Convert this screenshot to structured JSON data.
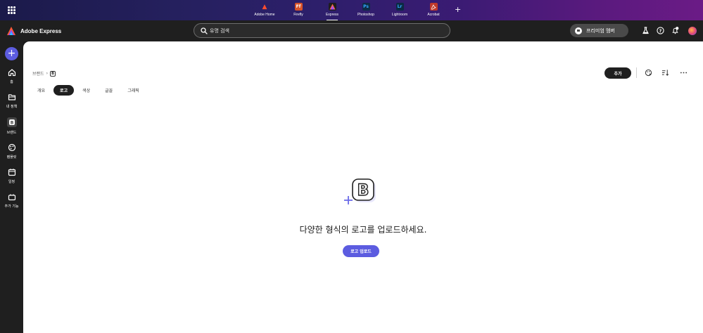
{
  "topbar": {
    "apps": [
      {
        "label": "Adobe Home",
        "icon": "adobe-home-icon",
        "color": "#e8452c",
        "glyph": "A"
      },
      {
        "label": "Firefly",
        "icon": "firefly-icon",
        "color": "#d8532a",
        "glyph": "Ff"
      },
      {
        "label": "Express",
        "icon": "express-icon",
        "color": "#1e1e1e",
        "glyph": "A"
      },
      {
        "label": "Photoshop",
        "icon": "photoshop-icon",
        "color": "#0f2c47",
        "glyph": "Ps"
      },
      {
        "label": "Lightroom",
        "icon": "lightroom-icon",
        "color": "#0c2a44",
        "glyph": "Lr"
      },
      {
        "label": "Acrobat",
        "icon": "acrobat-icon",
        "color": "#c0392b",
        "glyph": "A"
      }
    ],
    "add_app": "+"
  },
  "header": {
    "brand": "Adobe Express",
    "search_placeholder": "유명 검색",
    "premium_label": "프리미엄 멤버"
  },
  "rail": {
    "create": "+",
    "items": [
      {
        "label": "홈",
        "icon": "home-icon"
      },
      {
        "label": "내 정책",
        "icon": "folder-icon"
      },
      {
        "label": "브랜드",
        "icon": "brand-icon"
      },
      {
        "label": "템플릿",
        "icon": "templates-icon"
      },
      {
        "label": "일정",
        "icon": "calendar-icon"
      },
      {
        "label": "추가 기능",
        "icon": "add-ons-icon"
      }
    ]
  },
  "main": {
    "breadcrumb": {
      "root": "브랜드",
      "sep": "›",
      "current_logo": "B"
    },
    "tabs": [
      {
        "label": "개요",
        "active": false
      },
      {
        "label": "로고",
        "active": true
      },
      {
        "label": "색상",
        "active": false
      },
      {
        "label": "글꼴",
        "active": false
      },
      {
        "label": "그래픽",
        "active": false
      }
    ],
    "add_button": "추가",
    "empty_state": {
      "title": "다양한 형식의 로고를 업로드하세요.",
      "upload_button": "로고 업로드"
    }
  },
  "colors": {
    "accent": "#5c5ce0",
    "dark": "#1f1f1f"
  }
}
